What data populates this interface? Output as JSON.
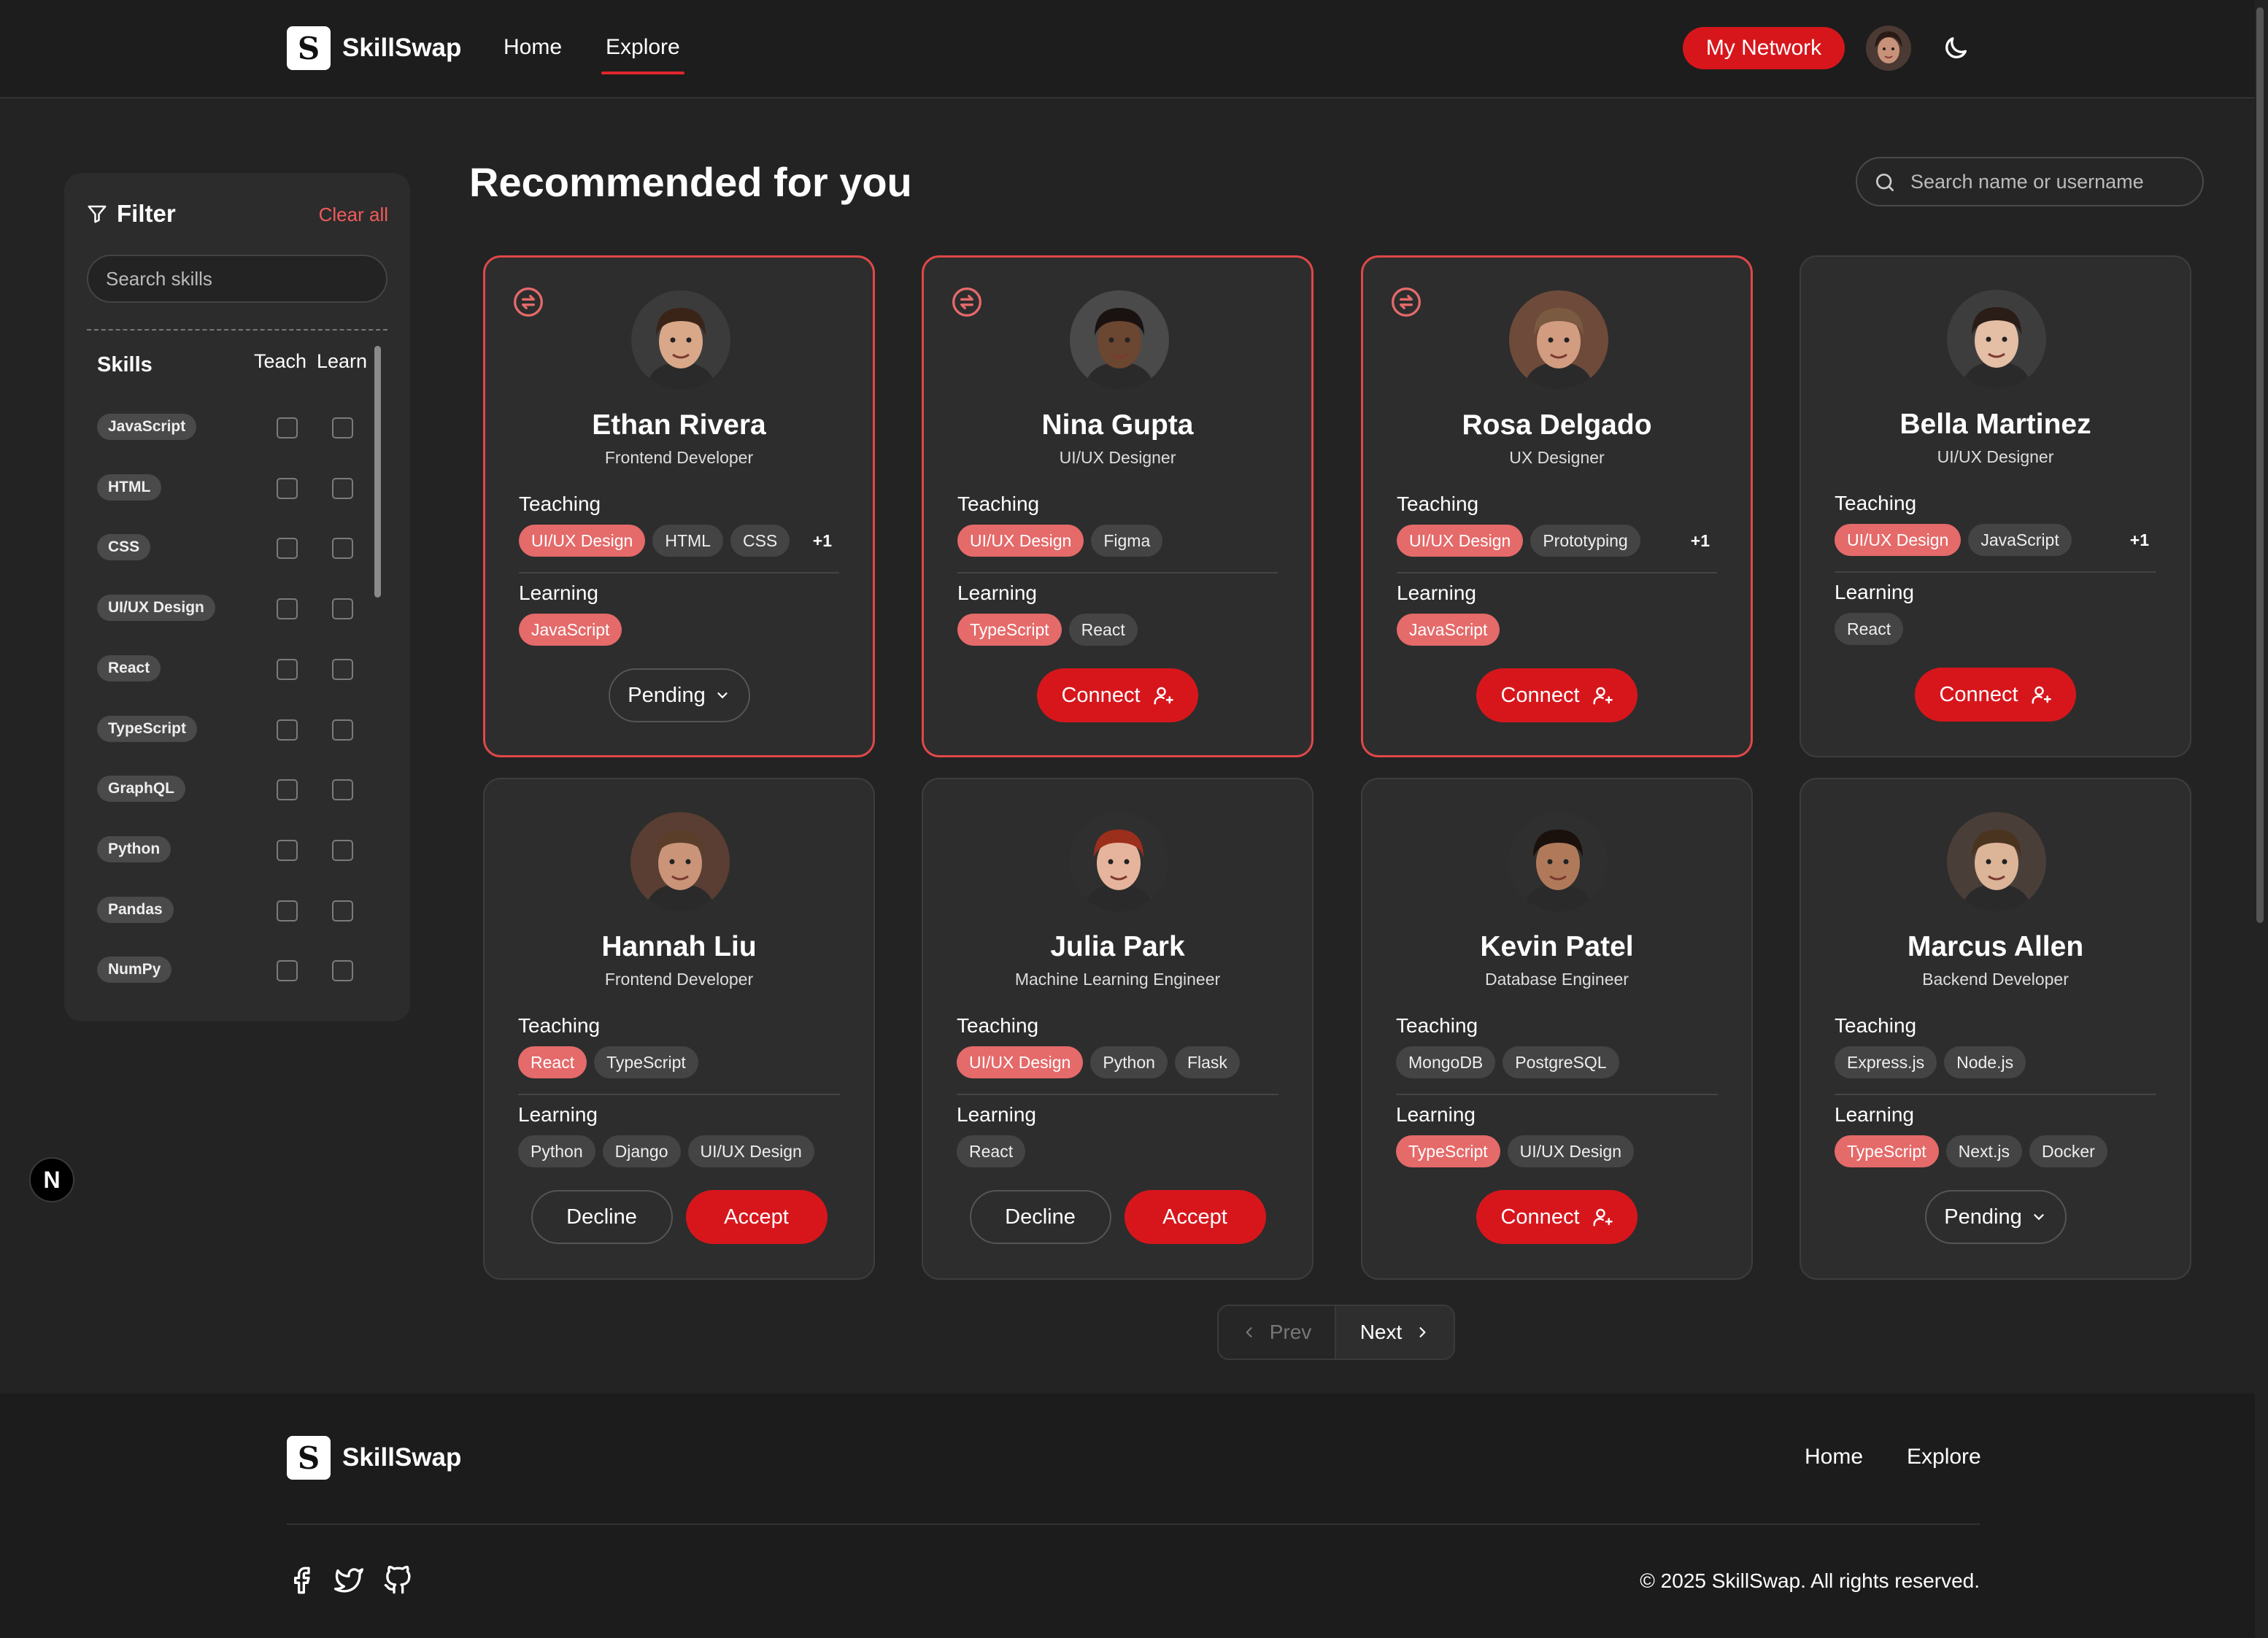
{
  "app": {
    "name": "SkillSwap",
    "logo_letter": "S"
  },
  "nav": {
    "home": "Home",
    "explore": "Explore",
    "active": "Explore",
    "network_button": "My Network"
  },
  "filter": {
    "title": "Filter",
    "clear_all": "Clear all",
    "search_placeholder": "Search skills",
    "skills_heading": "Skills",
    "teach_heading": "Teach",
    "learn_heading": "Learn",
    "skills": [
      "JavaScript",
      "HTML",
      "CSS",
      "UI/UX Design",
      "React",
      "TypeScript",
      "GraphQL",
      "Python",
      "Pandas",
      "NumPy"
    ]
  },
  "main": {
    "title": "Recommended for you",
    "search_placeholder": "Search name or username",
    "teaching_label": "Teaching",
    "learning_label": "Learning"
  },
  "labels": {
    "connect": "Connect",
    "pending": "Pending",
    "decline": "Decline",
    "accept": "Accept"
  },
  "cards": [
    {
      "name": "Ethan Rivera",
      "role": "Frontend Developer",
      "highlight": true,
      "teaching": [
        {
          "label": "UI/UX Design",
          "match": true
        },
        {
          "label": "HTML",
          "match": false
        },
        {
          "label": "CSS",
          "match": false
        }
      ],
      "teaching_more": "+1",
      "learning": [
        {
          "label": "JavaScript",
          "match": true
        }
      ],
      "action": "pending"
    },
    {
      "name": "Nina Gupta",
      "role": "UI/UX Designer",
      "highlight": true,
      "teaching": [
        {
          "label": "UI/UX Design",
          "match": true
        },
        {
          "label": "Figma",
          "match": false
        }
      ],
      "teaching_more": "",
      "learning": [
        {
          "label": "TypeScript",
          "match": true
        },
        {
          "label": "React",
          "match": false
        }
      ],
      "action": "connect"
    },
    {
      "name": "Rosa Delgado",
      "role": "UX Designer",
      "highlight": true,
      "teaching": [
        {
          "label": "UI/UX Design",
          "match": true
        },
        {
          "label": "Prototyping",
          "match": false
        }
      ],
      "teaching_more": "+1",
      "learning": [
        {
          "label": "JavaScript",
          "match": true
        }
      ],
      "action": "connect"
    },
    {
      "name": "Bella Martinez",
      "role": "UI/UX Designer",
      "highlight": false,
      "teaching": [
        {
          "label": "UI/UX Design",
          "match": true
        },
        {
          "label": "JavaScript",
          "match": false
        }
      ],
      "teaching_more": "+1",
      "learning": [
        {
          "label": "React",
          "match": false
        }
      ],
      "action": "connect"
    },
    {
      "name": "Hannah Liu",
      "role": "Frontend Developer",
      "highlight": false,
      "teaching": [
        {
          "label": "React",
          "match": true
        },
        {
          "label": "TypeScript",
          "match": false
        }
      ],
      "teaching_more": "",
      "learning": [
        {
          "label": "Python",
          "match": false
        },
        {
          "label": "Django",
          "match": false
        },
        {
          "label": "UI/UX Design",
          "match": false
        }
      ],
      "action": "respond"
    },
    {
      "name": "Julia Park",
      "role": "Machine Learning Engineer",
      "highlight": false,
      "teaching": [
        {
          "label": "UI/UX Design",
          "match": true
        },
        {
          "label": "Python",
          "match": false
        },
        {
          "label": "Flask",
          "match": false
        }
      ],
      "teaching_more": "",
      "learning": [
        {
          "label": "React",
          "match": false
        }
      ],
      "action": "respond"
    },
    {
      "name": "Kevin Patel",
      "role": "Database Engineer",
      "highlight": false,
      "teaching": [
        {
          "label": "MongoDB",
          "match": false
        },
        {
          "label": "PostgreSQL",
          "match": false
        }
      ],
      "teaching_more": "",
      "learning": [
        {
          "label": "TypeScript",
          "match": true
        },
        {
          "label": "UI/UX Design",
          "match": false
        }
      ],
      "action": "connect"
    },
    {
      "name": "Marcus Allen",
      "role": "Backend Developer",
      "highlight": false,
      "teaching": [
        {
          "label": "Express.js",
          "match": false
        },
        {
          "label": "Node.js",
          "match": false
        }
      ],
      "teaching_more": "",
      "learning": [
        {
          "label": "TypeScript",
          "match": true
        },
        {
          "label": "Next.js",
          "match": false
        },
        {
          "label": "Docker",
          "match": false
        }
      ],
      "action": "pending"
    }
  ],
  "pagination": {
    "prev": "Prev",
    "next": "Next"
  },
  "floating_badge": "N",
  "footer": {
    "home": "Home",
    "explore": "Explore",
    "copyright": "© 2025 SkillSwap. All rights reserved.",
    "social_icons": [
      "facebook-icon",
      "twitter-icon",
      "github-icon"
    ]
  },
  "colors": {
    "accent": "#d7161c",
    "match_chip": "#e56a6a",
    "background": "#232323"
  }
}
